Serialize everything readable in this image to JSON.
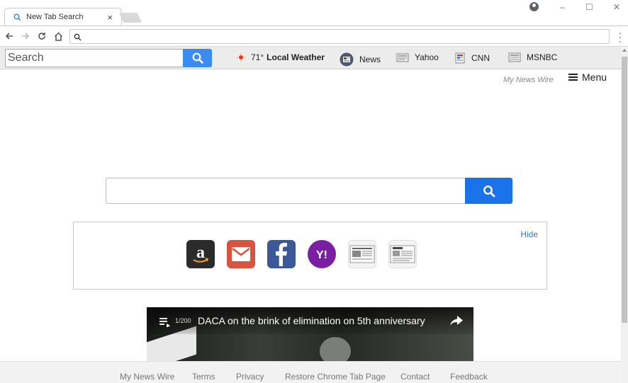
{
  "browser": {
    "tab_title": "New Tab Search",
    "tab_close": "×",
    "omnibox_value": "",
    "window_controls": [
      "–",
      "☐",
      "✕"
    ]
  },
  "extension_bar": {
    "search_placeholder": "Search",
    "weather_temp": "71°",
    "weather_label": "Local Weather",
    "links": [
      "News",
      "Yahoo",
      "CNN",
      "MSNBC"
    ]
  },
  "page": {
    "brand": "My News Wire",
    "menu_label": "Menu",
    "search_placeholder": "",
    "shortcuts_hide": "Hide",
    "shortcut_icons": [
      "amazon-icon",
      "gmail-icon",
      "facebook-icon",
      "yahoo-icon",
      "newspaper-icon",
      "daily-news-icon"
    ]
  },
  "video": {
    "count": "1/200",
    "title": "DACA on the brink of elimination on 5th anniversary"
  },
  "footer": {
    "links": [
      "My News Wire",
      "Terms",
      "Privacy",
      "Restore Chrome Tab Page",
      "Contact",
      "Feedback"
    ]
  },
  "colors": {
    "accent_blue": "#1a73e8",
    "ext_search_blue": "#3b8cf0",
    "hide_link": "#3a74c4"
  }
}
